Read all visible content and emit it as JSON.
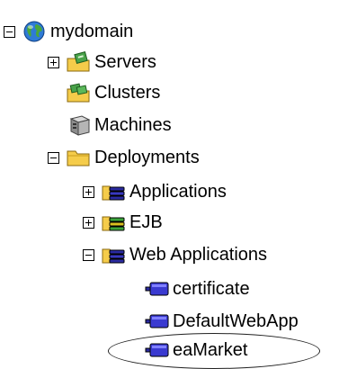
{
  "tree": {
    "root": {
      "label": "mydomain",
      "icon": "globe-icon",
      "expanded": true
    },
    "servers": {
      "label": "Servers",
      "icon": "servers-icon",
      "expanded": false
    },
    "clusters": {
      "label": "Clusters",
      "icon": "clusters-icon"
    },
    "machines": {
      "label": "Machines",
      "icon": "machine-icon"
    },
    "deployments": {
      "label": "Deployments",
      "icon": "folder-icon",
      "expanded": true
    },
    "applications": {
      "label": "Applications",
      "icon": "app-stack-icon",
      "expanded": false
    },
    "ejb": {
      "label": "EJB",
      "icon": "ejb-stack-icon",
      "expanded": false
    },
    "web_applications": {
      "label": "Web Applications",
      "icon": "web-stack-icon",
      "expanded": true
    },
    "certificate": {
      "label": "certificate",
      "icon": "webapp-icon"
    },
    "default_web_app": {
      "label": "DefaultWebApp",
      "icon": "webapp-icon"
    },
    "ea_market": {
      "label": "eaMarket",
      "icon": "webapp-icon",
      "highlighted": true
    }
  },
  "colors": {
    "folder": "#f5cc4a",
    "webapp": "#2a2aa0",
    "highlight_ring": "#222222"
  }
}
